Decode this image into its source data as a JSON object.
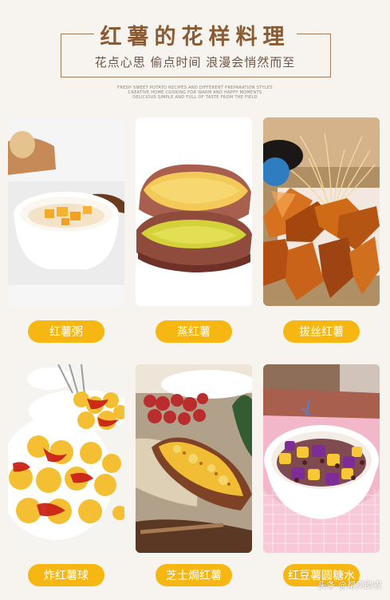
{
  "header": {
    "title": "红薯的花样料理",
    "subtitle": "花点心思 偷点时间 浪漫会悄然而至",
    "small_lines": [
      "FRESH SWEET POTATO RECIPES AND DIFFERENT PREPARATION STYLES",
      "CREATIVE HOME COOKING FOR WARM AND HAPPY MOMENTS",
      "DELICIOUS SIMPLE AND FULL OF TASTE FROM THE FIELD"
    ]
  },
  "recipes": [
    {
      "name": "红薯粥"
    },
    {
      "name": "蒸红薯"
    },
    {
      "name": "拔丝红薯"
    },
    {
      "name": "炸红薯球"
    },
    {
      "name": "芝士焗红薯"
    },
    {
      "name": "红豆薯圆糖水"
    }
  ],
  "watermark": "头条 @帮卖助农",
  "colors": {
    "background": "#f7f3ee",
    "title": "#8a5a33",
    "label_background": "#f6b712",
    "label_text": "#ffffff"
  }
}
